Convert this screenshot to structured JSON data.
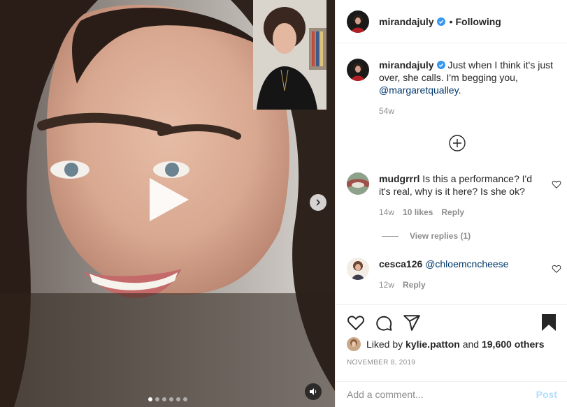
{
  "post": {
    "username": "mirandajuly",
    "following_label": "Following",
    "bullet": "•",
    "verified_icon": "verified-badge-icon",
    "caption": {
      "username": "mirandajuly",
      "text": "Just when I think it's just over, she calls. I'm begging you,",
      "mention": "@margaretqualley",
      "after_mention": ".",
      "age": "54w"
    }
  },
  "comments": [
    {
      "username": "mudgrrrl",
      "text": "Is this a performance? I'd it's real, why is it here? Is she ok?",
      "age": "14w",
      "likes": "10 likes",
      "reply_label": "Reply"
    },
    {
      "username": "cesca126",
      "text": "",
      "mention": "@chloemcncheese",
      "age": "12w",
      "reply_label": "Reply"
    }
  ],
  "view_replies": "View replies (1)",
  "likes": {
    "prefix": "Liked by",
    "user": "kylie.patton",
    "and": "and",
    "count": "19,600 others"
  },
  "date": "NOVEMBER 8, 2019",
  "add_comment": {
    "placeholder": "Add a comment...",
    "post_label": "Post"
  },
  "carousel": {
    "count": 6,
    "active": 0
  },
  "colors": {
    "text": "#262626",
    "secondary": "#8e8e8e",
    "mention": "#00376b",
    "post_disabled": "#b2dffc",
    "verified": "#3897f0"
  }
}
